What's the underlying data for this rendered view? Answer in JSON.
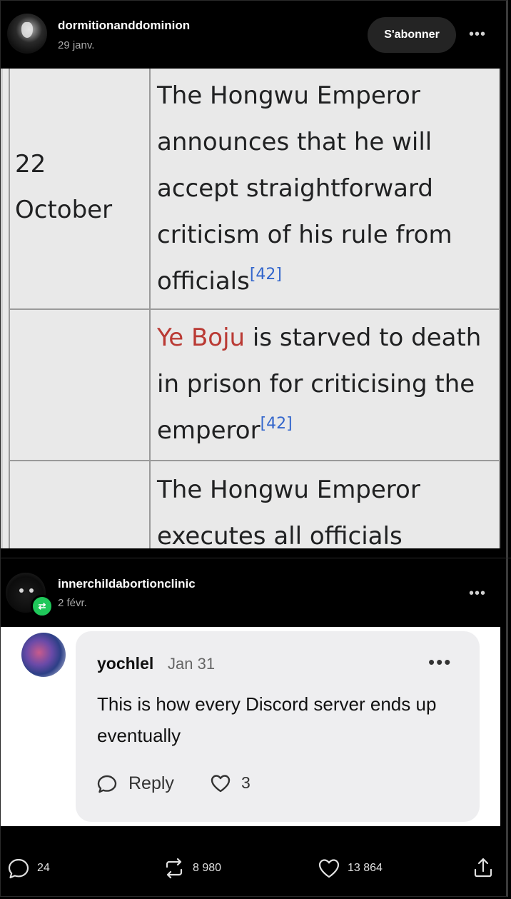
{
  "post": {
    "username": "dormitionanddominion",
    "date": "29 janv.",
    "subscribe_label": "S'abonner",
    "more_label": "•••"
  },
  "wiki": {
    "row1_date_line1": "22",
    "row1_date_line2": "October",
    "row1_lines": [
      "The Hongwu Emperor",
      "announces that he will",
      "accept straightforward",
      "criticism of his rule from",
      "officials"
    ],
    "ref": "[42]",
    "row2_link": "Ye Boju",
    "row2_line1_rest": " is starved to death",
    "row2_line2": "in prison for criticising the",
    "row2_line3": "emperor",
    "row3_line1": "The Hongwu Emperor",
    "row3_line2": "executes all officials"
  },
  "reblog": {
    "username": "innerchildabortionclinic",
    "date": "2 févr.",
    "more_label": "•••"
  },
  "comment": {
    "username": "yochlel",
    "date": "Jan 31",
    "more_label": "•••",
    "text": "This is how every Discord server ends up eventually",
    "reply_label": "Reply",
    "like_count": "3"
  },
  "footer": {
    "comments": "24",
    "reblogs": "8 980",
    "likes": "13 864"
  }
}
